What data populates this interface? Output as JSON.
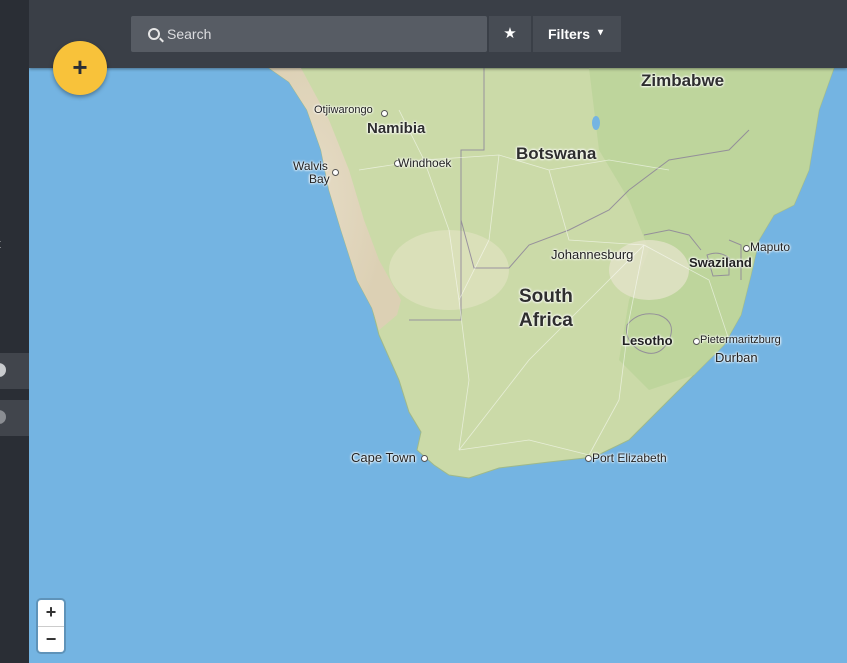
{
  "search": {
    "placeholder": "Search",
    "value": ""
  },
  "toolbar": {
    "favorite_icon": "star-icon",
    "filters_label": "Filters",
    "filters_icon": "chevron-down-icon"
  },
  "fab": {
    "label": "+",
    "color": "#f8c23a"
  },
  "sidebar": {
    "partial_text": "t"
  },
  "zoom": {
    "in_label": "+",
    "out_label": "−"
  },
  "map": {
    "water_color": "#74b4e2",
    "land_color": "#cfdcb0",
    "marker": {
      "name": "location-pin-icon",
      "color": "#0e5f96"
    },
    "countries": {
      "zimbabwe": "Zimbabwe",
      "namibia": "Namibia",
      "botswana": "Botswana",
      "south_africa_1": "South",
      "south_africa_2": "Africa",
      "lesotho": "Lesotho",
      "swaziland": "Swaziland"
    },
    "cities": {
      "otjiwarongo": "Otjiwarongo",
      "walvis_1": "Walvis",
      "walvis_2": "Bay",
      "windhoek": "Windhoek",
      "johannesburg": "Johannesburg",
      "maputo": "Maputo",
      "pietermaritzburg": "Pietermaritzburg",
      "durban": "Durban",
      "cape_town": "Cape Town",
      "port_elizabeth": "Port Elizabeth"
    }
  }
}
